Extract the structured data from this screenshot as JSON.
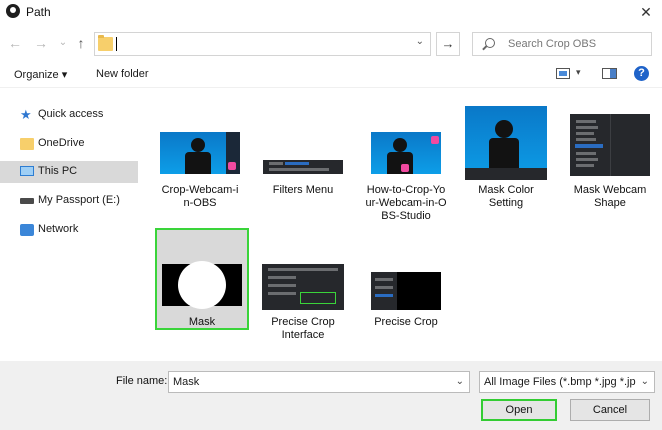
{
  "window": {
    "title": "Path",
    "close_glyph": "✕"
  },
  "nav": {
    "back_glyph": "←",
    "forward_glyph": "→",
    "recent_glyph": "⌄",
    "up_glyph": "↑",
    "address_value": "",
    "address_dropdown_glyph": "⌄",
    "go_glyph": "→",
    "search_placeholder": "Search Crop OBS"
  },
  "toolbar": {
    "organize_label": "Organize ▾",
    "new_folder_label": "New folder",
    "view_caret": "▾",
    "help_glyph": "?"
  },
  "sidebar": {
    "items": [
      {
        "label": "Quick access",
        "icon": "star-icon"
      },
      {
        "label": "OneDrive",
        "icon": "folder-icon"
      },
      {
        "label": "This PC",
        "icon": "computer-icon",
        "selected": true
      },
      {
        "label": "My Passport (E:)",
        "icon": "drive-icon"
      },
      {
        "label": "Network",
        "icon": "network-icon"
      }
    ]
  },
  "files": [
    {
      "label": "Crop-Webcam-i\nn-OBS"
    },
    {
      "label": "Filters Menu"
    },
    {
      "label": "How-to-Crop-Yo\nur-Webcam-in-O\nBS-Studio"
    },
    {
      "label": "Mask Color\nSetting"
    },
    {
      "label": "Mask Webcam\nShape"
    },
    {
      "label": "Mask",
      "selected": true
    },
    {
      "label": "Precise Crop\nInterface"
    },
    {
      "label": "Precise Crop"
    }
  ],
  "footer": {
    "file_name_label": "File name:",
    "file_name_value": "Mask",
    "file_type_value": "All Image Files (*.bmp *.jpg *.jp",
    "dropdown_glyph": "⌄",
    "open_label": "Open",
    "cancel_label": "Cancel"
  },
  "colors": {
    "highlight_green": "#33cc33",
    "selection_grey": "#d9d9d9",
    "accent_blue": "#1f63c9"
  }
}
